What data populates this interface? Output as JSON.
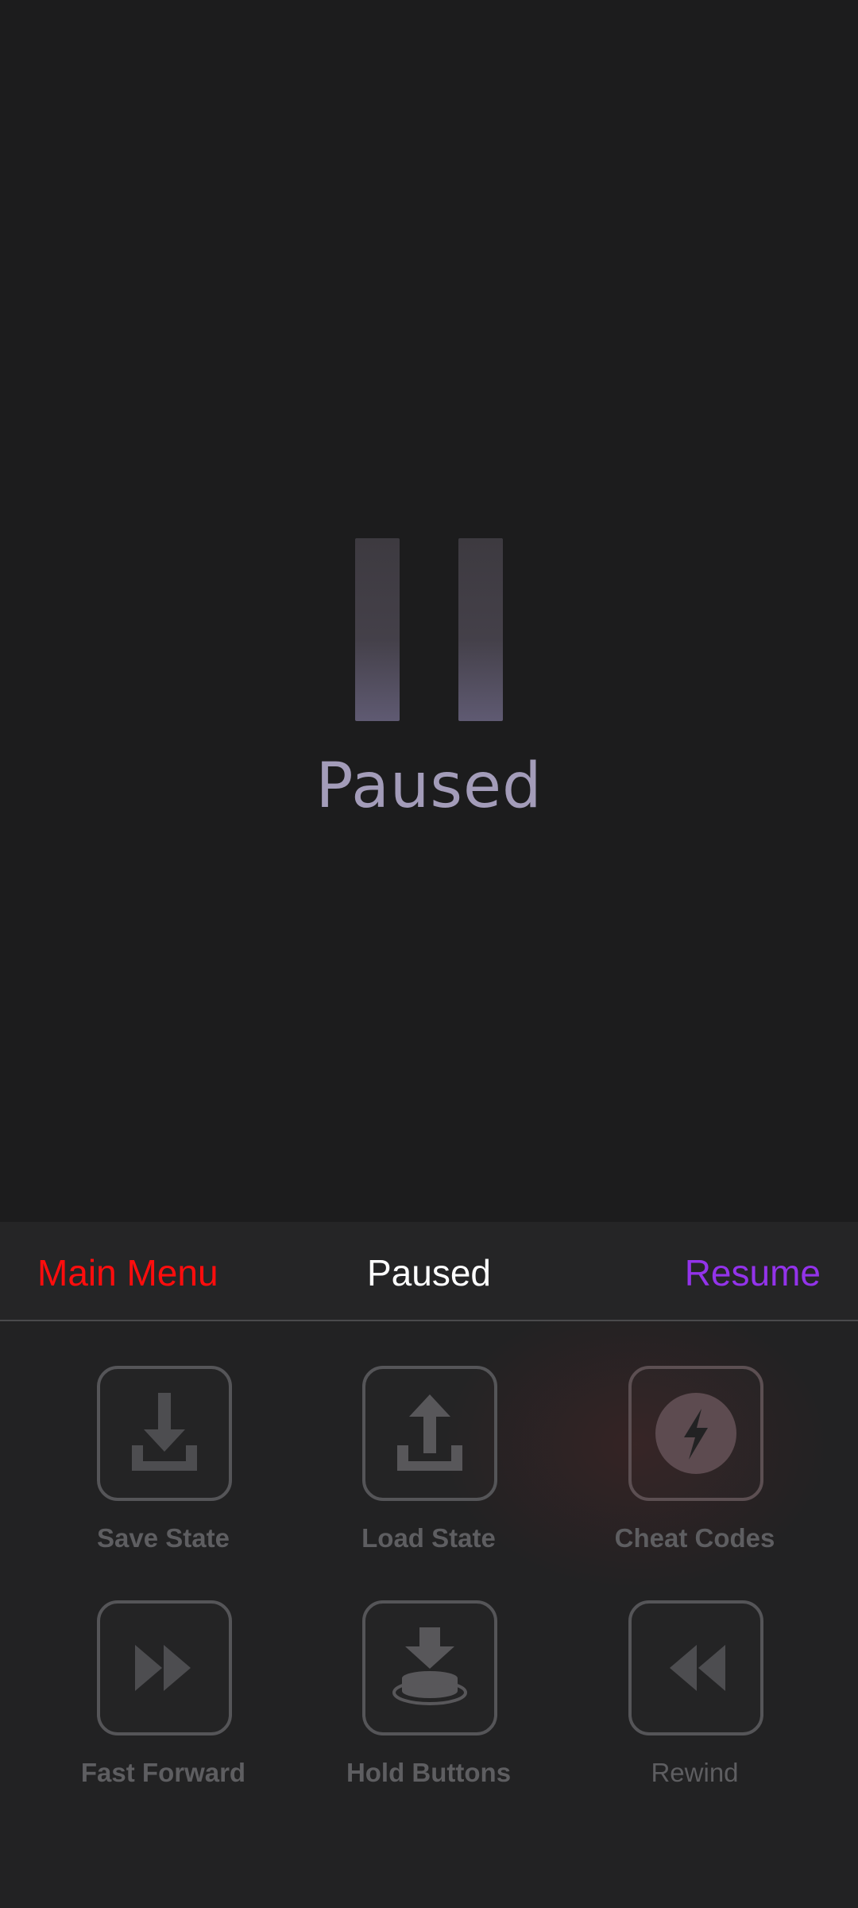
{
  "overlay": {
    "pause_icon": "pause-icon",
    "caption": "Paused"
  },
  "pause_menu": {
    "nav": {
      "left_label": "Main Menu",
      "title": "Paused",
      "right_label": "Resume"
    },
    "colors": {
      "main_menu": "#ff0d0d",
      "resume": "#9333ea",
      "title": "#ffffff",
      "item": "#5e5e61"
    },
    "items": [
      {
        "label": "Save State",
        "icon": "save-state-icon"
      },
      {
        "label": "Load State",
        "icon": "load-state-icon"
      },
      {
        "label": "Cheat Codes",
        "icon": "cheat-codes-icon"
      },
      {
        "label": "Fast Forward",
        "icon": "fast-forward-icon"
      },
      {
        "label": "Hold Buttons",
        "icon": "hold-buttons-icon"
      },
      {
        "label": "Rewind",
        "icon": "rewind-icon"
      }
    ]
  }
}
